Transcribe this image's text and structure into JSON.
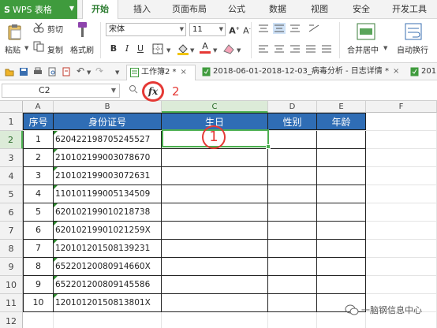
{
  "app": {
    "name": "WPS 表格",
    "menu_tabs": [
      "开始",
      "插入",
      "页面布局",
      "公式",
      "数据",
      "视图",
      "安全",
      "开发工具"
    ],
    "active_tab": "开始"
  },
  "ribbon": {
    "cut": "剪切",
    "paste": "粘贴",
    "copy": "复制",
    "format_painter": "格式刷",
    "font_name": "宋体",
    "font_size": "11",
    "bold": "B",
    "italic": "I",
    "underline": "U",
    "font_color_glyph": "A",
    "merge_center": "合并居中",
    "wrap_text": "自动换行"
  },
  "doc_tabs": [
    {
      "label": "工作簿2 *",
      "active": true
    },
    {
      "label": "2018-06-01-2018-12-03_病毒分析 - 日志详情 *",
      "active": false
    },
    {
      "label": "201",
      "active": false
    }
  ],
  "formula_bar": {
    "cell_ref": "C2",
    "fx": "fx",
    "value": ""
  },
  "annotations": {
    "fx_marker": "2",
    "cell_marker": "1"
  },
  "columns": [
    "A",
    "B",
    "C",
    "D",
    "E",
    "F"
  ],
  "rows": [
    "1",
    "2",
    "3",
    "4",
    "5",
    "6",
    "7",
    "8",
    "9",
    "10",
    "11",
    "12"
  ],
  "table": {
    "headers": [
      "序号",
      "身份证号",
      "生日",
      "性别",
      "年龄"
    ],
    "rows": [
      [
        "1",
        "620422198705245527"
      ],
      [
        "2",
        "210102199003078670"
      ],
      [
        "3",
        "210102199003072631"
      ],
      [
        "4",
        "110101199005134509"
      ],
      [
        "5",
        "620102199010218738"
      ],
      [
        "6",
        "62010219901021259X"
      ],
      [
        "7",
        "120101201508139231"
      ],
      [
        "8",
        "65220120080914660X"
      ],
      [
        "9",
        "652201200809145586"
      ],
      [
        "10",
        "12010120150813801X"
      ]
    ]
  },
  "watermark": "一脑钢信息中心",
  "colors": {
    "app_green": "#3f9b3d",
    "header_blue": "#2f6db5",
    "annotation_red": "#e53935",
    "selection_green": "#4caf50"
  }
}
